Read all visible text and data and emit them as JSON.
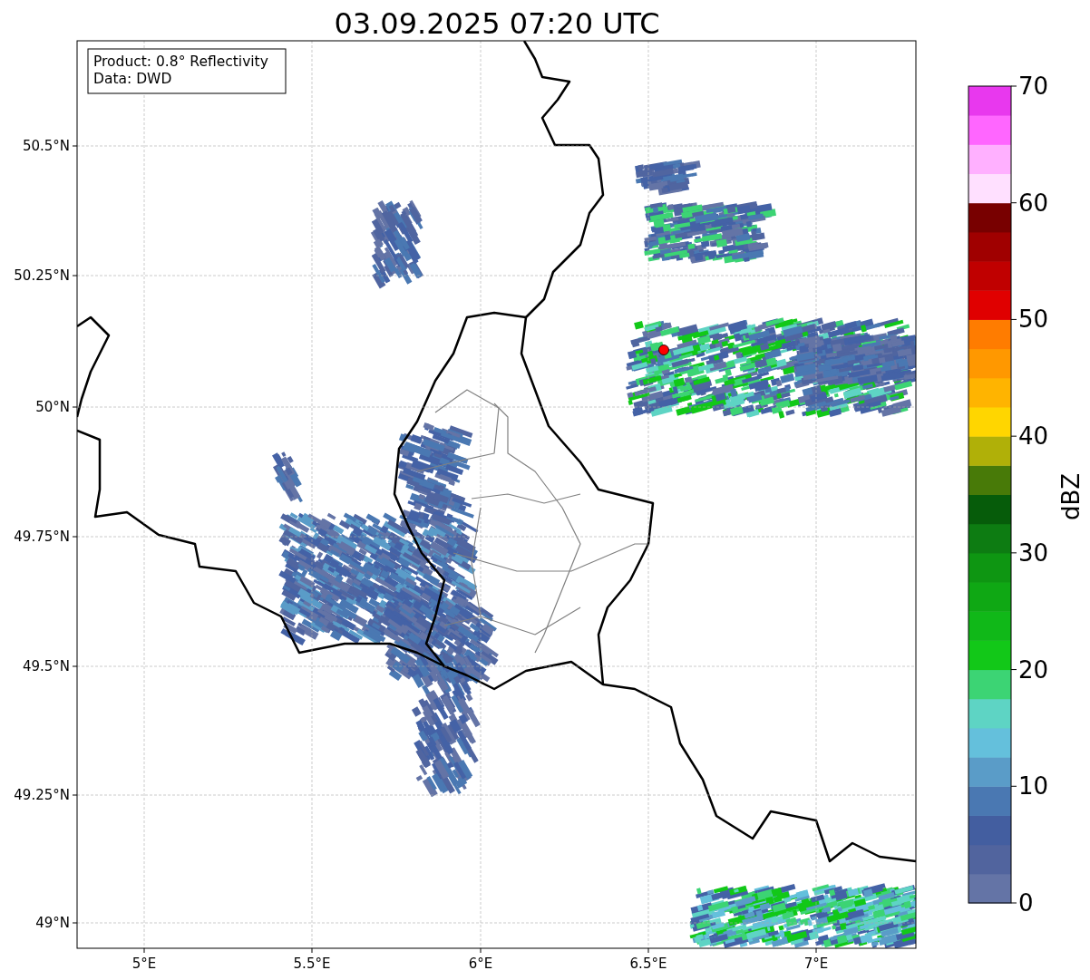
{
  "title": "03.09.2025 07:20 UTC",
  "legend": [
    "Product: 0.8° Reflectivity",
    "Data: DWD"
  ],
  "x_ticks": [
    "5°E",
    "5.5°E",
    "6°E",
    "6.5°E",
    "7°E"
  ],
  "y_ticks": [
    "50.5°N",
    "50.25°N",
    "50°N",
    "49.75°N",
    "49.5°N",
    "49.25°N",
    "49°N"
  ],
  "colorbar": {
    "label": "dBZ",
    "ticks": [
      "70",
      "60",
      "50",
      "40",
      "30",
      "20",
      "10",
      "0"
    ],
    "segments": [
      {
        "color": "#6474a6"
      },
      {
        "color": "#51649e"
      },
      {
        "color": "#435ea0"
      },
      {
        "color": "#4a78b2"
      },
      {
        "color": "#5a9cc8"
      },
      {
        "color": "#64c0dc"
      },
      {
        "color": "#5ed4c4"
      },
      {
        "color": "#3cd474"
      },
      {
        "color": "#12c818"
      },
      {
        "color": "#10b818"
      },
      {
        "color": "#0fa814"
      },
      {
        "color": "#0e9612"
      },
      {
        "color": "#0d7c12"
      },
      {
        "color": "#065c0a"
      },
      {
        "color": "#487a08"
      },
      {
        "color": "#b0b008"
      },
      {
        "color": "#ffd600"
      },
      {
        "color": "#ffb400"
      },
      {
        "color": "#ff9800"
      },
      {
        "color": "#ff7c00"
      },
      {
        "color": "#e00000"
      },
      {
        "color": "#c00000"
      },
      {
        "color": "#a00000"
      },
      {
        "color": "#780000"
      },
      {
        "color": "#ffe0ff"
      },
      {
        "color": "#ffb0ff"
      },
      {
        "color": "#ff66ff"
      },
      {
        "color": "#e838ee"
      }
    ]
  }
}
